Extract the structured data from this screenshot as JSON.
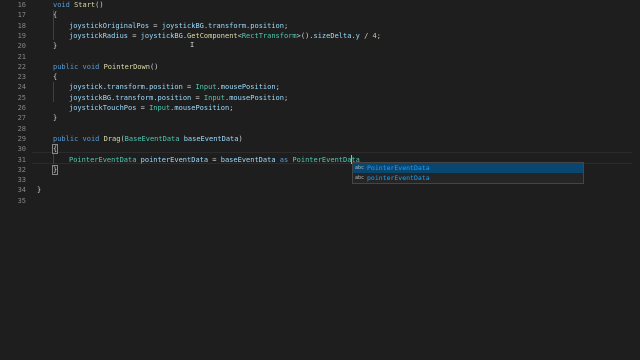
{
  "editor": {
    "line_numbers": [
      "16",
      "17",
      "18",
      "19",
      "20",
      "21",
      "22",
      "23",
      "24",
      "25",
      "26",
      "27",
      "28",
      "29",
      "30",
      "31",
      "32",
      "33",
      "34",
      "35"
    ],
    "code": {
      "l16": {
        "kw": "void",
        "fn": "Start",
        "rest": "()"
      },
      "l17": {
        "text": "{"
      },
      "l18": {
        "a": "joystickOriginalPos",
        "b": " = ",
        "c": "joystickBG",
        "d": ".",
        "e": "transform",
        "f": ".",
        "g": "position",
        "h": ";"
      },
      "l19": {
        "a": "joystickRadius",
        "b": " = ",
        "c": "joystickBG",
        "d": ".",
        "e": "GetComponent",
        "f": "<",
        "g": "RectTransform",
        "h": ">().",
        "i": "sizeDelta",
        "j": ".",
        "k": "y",
        "l": " / ",
        "m": "4",
        "n": ";"
      },
      "l20": {
        "text": "}"
      },
      "l22": {
        "kw1": "public",
        "kw2": "void",
        "fn": "PointerDown",
        "rest": "()"
      },
      "l23": {
        "text": "{"
      },
      "l24": {
        "a": "joystick",
        "b": ".",
        "c": "transform",
        "d": ".",
        "e": "position",
        "f": " = ",
        "g": "Input",
        "h": ".",
        "i": "mousePosition",
        "j": ";"
      },
      "l25": {
        "a": "joystickBG",
        "b": ".",
        "c": "transform",
        "d": ".",
        "e": "position",
        "f": " = ",
        "g": "Input",
        "h": ".",
        "i": "mousePosition",
        "j": ";"
      },
      "l26": {
        "a": "joystickTouchPos",
        "b": " = ",
        "c": "Input",
        "d": ".",
        "e": "mousePosition",
        "f": ";"
      },
      "l27": {
        "text": "}"
      },
      "l29": {
        "kw1": "public",
        "kw2": "void",
        "fn": "Drag",
        "p1": "(",
        "ty": "BaseEventData",
        "id": "baseEventData",
        "p2": ")"
      },
      "l30": {
        "text": "{"
      },
      "l31": {
        "ty": "PointerEventData",
        "id": "pointerEventData",
        "eq": " = ",
        "id2": "baseEventData",
        "kw": "as",
        "ty2": "PointerEventData"
      },
      "l32": {
        "text": "}"
      },
      "l34": {
        "text": "}"
      }
    }
  },
  "suggest": {
    "items": [
      {
        "icon": "abc",
        "label": "PointerEventData",
        "selected": true
      },
      {
        "icon": "abc",
        "label": "pointerEventData",
        "selected": false
      }
    ]
  },
  "colors": {
    "background": "#1e1e1e",
    "keyword": "#569cd6",
    "function": "#dcdcaa",
    "type": "#4ec9b0",
    "identifier": "#9cdcfe",
    "suggest_selected": "#094771",
    "suggest_match": "#18a3ff"
  }
}
